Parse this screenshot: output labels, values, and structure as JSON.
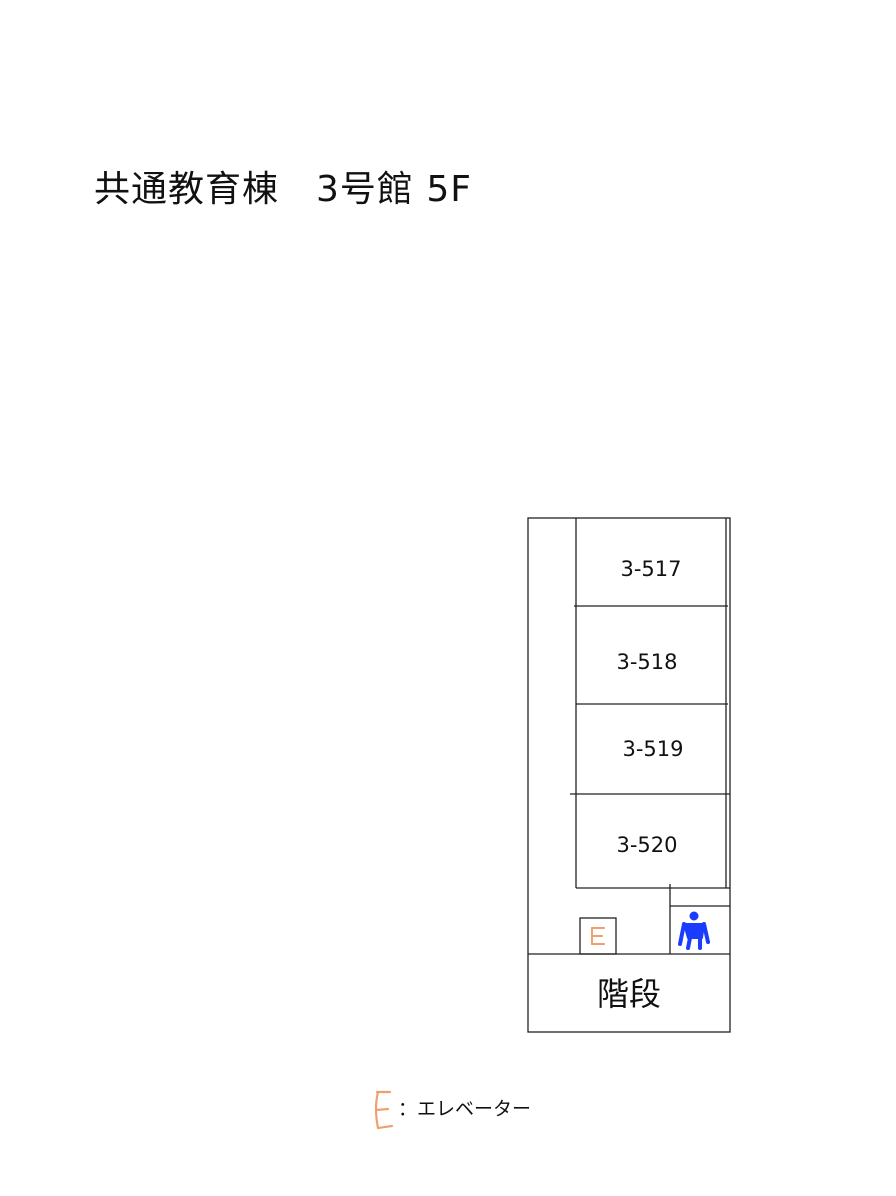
{
  "title": "共通教育棟　3号館 5F",
  "rooms": [
    {
      "label": "3-517"
    },
    {
      "label": "3-518"
    },
    {
      "label": "3-519"
    },
    {
      "label": "3-520"
    }
  ],
  "stairs": {
    "label": "階段"
  },
  "legend": {
    "text": "：エレベーター"
  },
  "icons": {
    "elevator": "elevator-E-icon",
    "restroom": "restroom-person-icon"
  },
  "colors": {
    "elevator": "#f0a070",
    "restroom": "#1a3cff",
    "lines": "#222222"
  }
}
